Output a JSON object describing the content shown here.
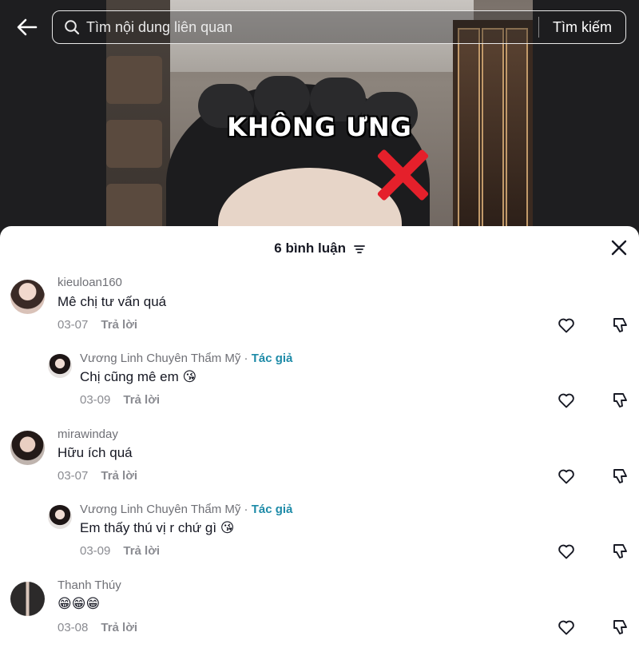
{
  "header": {
    "search_placeholder": "Tìm nội dung liên quan",
    "search_button": "Tìm kiếm"
  },
  "video": {
    "overlay_text": "KHÔNG ƯNG"
  },
  "sheet": {
    "title": "6 bình luận"
  },
  "comments": [
    {
      "user": "kieuloan160",
      "text": "Mê chị tư vấn quá",
      "date": "03-07",
      "reply": "Trả lời"
    },
    {
      "user": "Vương Linh Chuyên Thẩm Mỹ · ",
      "author_tag": "Tác giả",
      "text": "Chị cũng mê em 😘",
      "date": "03-09",
      "reply": "Trả lời"
    },
    {
      "user": "mirawinday",
      "text": "Hữu ích quá",
      "date": "03-07",
      "reply": "Trả lời"
    },
    {
      "user": "Vương Linh Chuyên Thẩm Mỹ · ",
      "author_tag": "Tác giả",
      "text": "Em thấy thú vị r chứ gì 😘",
      "date": "03-09",
      "reply": "Trả lời"
    },
    {
      "user": "Thanh Thúy",
      "text": "😁😁😁",
      "date": "03-08",
      "reply": "Trả lời"
    }
  ],
  "colors": {
    "author_tag": "#1e8ba8",
    "cross": "#e5202b"
  }
}
